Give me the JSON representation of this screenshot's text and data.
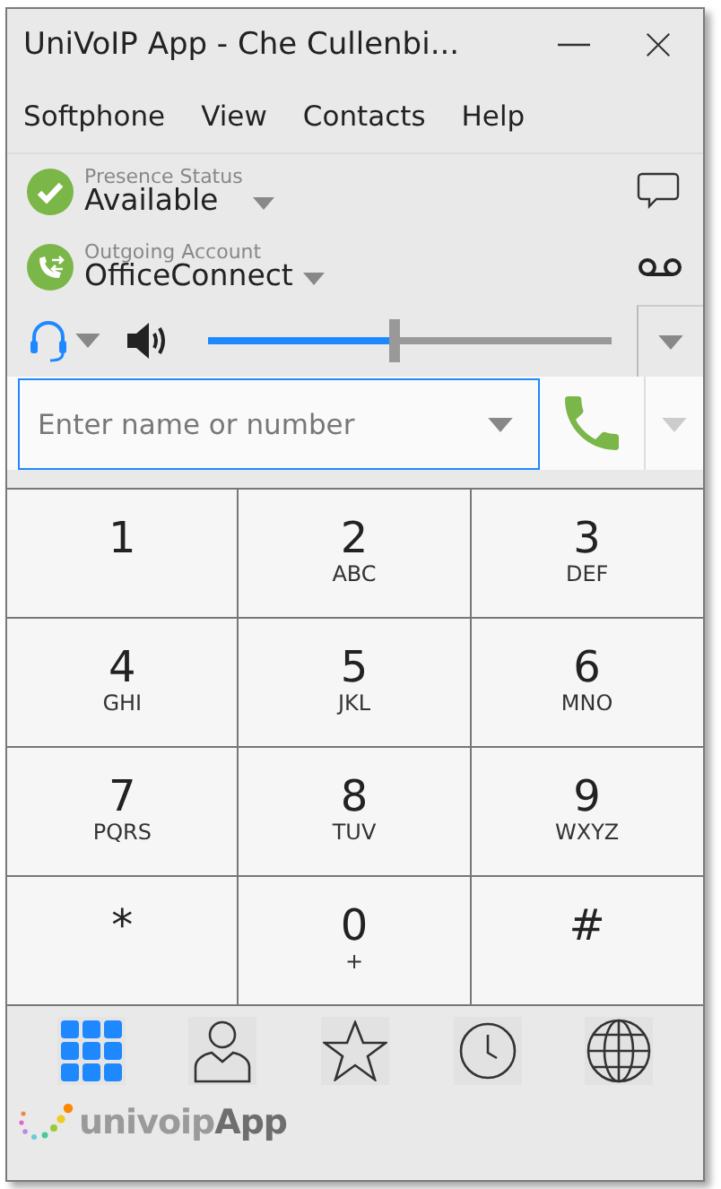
{
  "window": {
    "title": "UniVoIP App - Che Cullenbi..."
  },
  "menu": [
    "Softphone",
    "View",
    "Contacts",
    "Help"
  ],
  "presence": {
    "label": "Presence Status",
    "value": "Available"
  },
  "account": {
    "label": "Outgoing Account",
    "value": "OfficeConnect"
  },
  "volume": {
    "level": 0.46
  },
  "dial_field": {
    "placeholder": "Enter name or number"
  },
  "keypad": [
    {
      "digit": "1"
    },
    {
      "digit": "2",
      "letters": "ABC"
    },
    {
      "digit": "3",
      "letters": "DEF"
    },
    {
      "digit": "4",
      "letters": "GHI"
    },
    {
      "digit": "5",
      "letters": "JKL"
    },
    {
      "digit": "6",
      "letters": "MNO"
    },
    {
      "digit": "7",
      "letters": "PQRS"
    },
    {
      "digit": "8",
      "letters": "TUV"
    },
    {
      "digit": "9",
      "letters": "WXYZ"
    },
    {
      "digit": "*"
    },
    {
      "digit": "0",
      "letters": "+"
    },
    {
      "digit": "#"
    }
  ],
  "nav": [
    {
      "kind": "dialpad",
      "selected": true
    },
    {
      "kind": "contacts",
      "selected": false
    },
    {
      "kind": "favorites",
      "selected": false
    },
    {
      "kind": "history",
      "selected": false
    },
    {
      "kind": "web",
      "selected": false
    }
  ],
  "logo": {
    "text": "univoip",
    "accent": "App"
  }
}
